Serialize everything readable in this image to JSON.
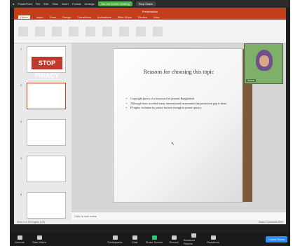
{
  "mac_menubar": {
    "items": [
      "PowerPoint",
      "File",
      "Edit",
      "View",
      "Insert",
      "Format",
      "Arrange"
    ],
    "sharing_badge": "You are screen sharing",
    "stop_share": "Stop Share"
  },
  "app": {
    "title": "Presentation"
  },
  "tabs": [
    "Home",
    "Insert",
    "Draw",
    "Design",
    "Transitions",
    "Animations",
    "Slide Show",
    "Review",
    "View"
  ],
  "thumbnails": [
    {
      "num": "1",
      "text": "STOP PIRACY"
    },
    {
      "num": "2",
      "text": ""
    },
    {
      "num": "3",
      "text": ""
    },
    {
      "num": "4",
      "text": ""
    },
    {
      "num": "5",
      "text": ""
    }
  ],
  "slide": {
    "title": "Reasons for choosing this topic",
    "bullets": [
      "Copyright piracy is a buzzword of present Bangladesh",
      "Although have acceded many international instruments but protection gap is there",
      "IP rights violation by piracy but not enough to protect piracy"
    ]
  },
  "notes_placeholder": "Click to add notes",
  "status": {
    "left": "Slide 2 of 15  English (US)",
    "right": "Notes  Comments  83%"
  },
  "video": {
    "name": "Nusrat"
  },
  "zoom": {
    "buttons": [
      "Unmute",
      "Start Video",
      "Participants",
      "Chat",
      "Share Screen",
      "Record",
      "Breakout Rooms",
      "Reactions"
    ],
    "leave": "Leave Room"
  },
  "colors": {
    "ppt_accent": "#c43e1c",
    "zoom_blue": "#2d8cff",
    "share_green": "#2ecc71"
  }
}
